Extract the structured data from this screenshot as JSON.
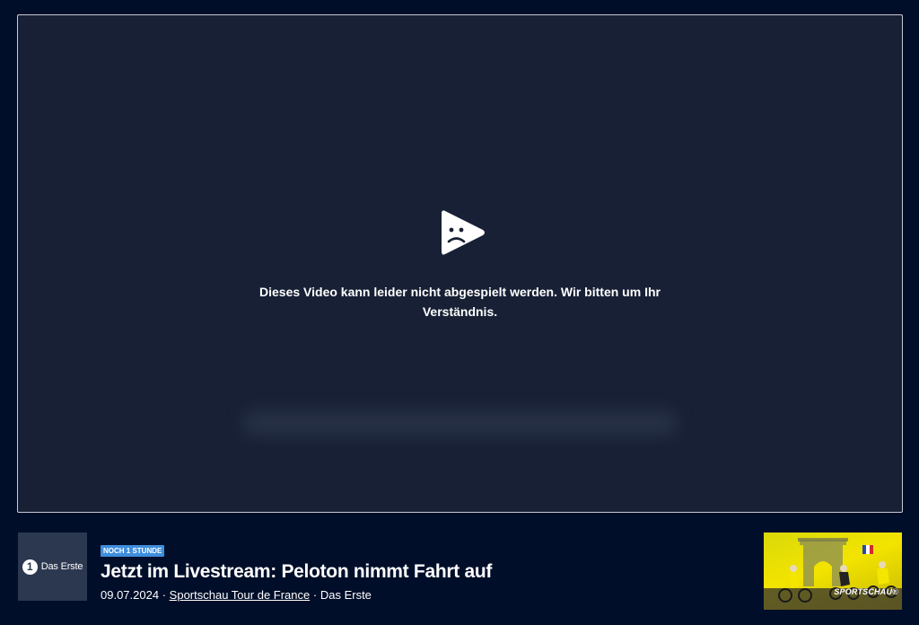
{
  "player": {
    "error_message": "Dieses Video kann leider nicht abgespielt werden. Wir bitten um Ihr Verständnis.",
    "error_icon": "sad-play-icon"
  },
  "channel": {
    "logo_mark": "1",
    "logo_text": "Das Erste"
  },
  "video": {
    "badge": "NOCH 1 STUNDE",
    "title": "Jetzt im Livestream: Peloton nimmt Fahrt auf",
    "date": "09.07.2024",
    "separator": "·",
    "show": "Sportschau Tour de France",
    "channel": "Das Erste"
  },
  "thumbnail": {
    "brand": "SPORTSCHAU®"
  },
  "colors": {
    "background": "#000e29",
    "player": "#172034",
    "badge": "#3e8edc",
    "thumbnail": "#f3e400"
  }
}
